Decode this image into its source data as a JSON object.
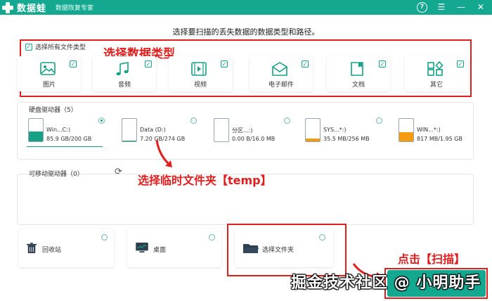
{
  "app": {
    "name": "数据蛙",
    "subtitle": "数据恢复专家"
  },
  "titlebar_buttons": [
    "help-icon",
    "menu-icon",
    "minimize-icon",
    "close-icon"
  ],
  "instruction": "选择要扫描的丢失数据的数据类型和路径。",
  "file_types": {
    "select_all_label": "选择所有文件类型",
    "items": [
      {
        "label": "图片",
        "icon": "image-icon",
        "checked": true
      },
      {
        "label": "音频",
        "icon": "music-icon",
        "checked": true
      },
      {
        "label": "视频",
        "icon": "video-icon",
        "checked": true
      },
      {
        "label": "电子邮件",
        "icon": "email-icon",
        "checked": true
      },
      {
        "label": "文档",
        "icon": "document-icon",
        "checked": true
      },
      {
        "label": "其它",
        "icon": "other-icon",
        "checked": true
      }
    ]
  },
  "hard_drives": {
    "title": "硬盘驱动器（5）",
    "items": [
      {
        "name": "Win...C:)",
        "size": "85.9 GB/200 GB",
        "selected": true,
        "used_fraction": 0.43,
        "fill_color": "#16a085"
      },
      {
        "name": "Data (D:)",
        "size": "7.20 GB/274 GB",
        "selected": false,
        "used_fraction": 0.03,
        "fill_color": "#16a085"
      },
      {
        "name": "分区...:)",
        "size": "0.00  B/16.0 MB",
        "selected": false,
        "used_fraction": 0.0,
        "fill_color": "#f39c12"
      },
      {
        "name": "SYS...*:)",
        "size": "35.5 MB/256 MB",
        "selected": false,
        "used_fraction": 0.14,
        "fill_color": "#f39c12"
      },
      {
        "name": "WIN...*:)",
        "size": "817 MB/1.95 GB",
        "selected": false,
        "used_fraction": 0.42,
        "fill_color": "#f39c12"
      }
    ]
  },
  "removable": {
    "title": "可移动驱动器（0）",
    "refresh_icon": "refresh-icon"
  },
  "locations": [
    {
      "label": "回收站",
      "icon": "recycle-bin-icon"
    },
    {
      "label": "桌面",
      "icon": "desktop-icon"
    },
    {
      "label": "选择文件夹",
      "icon": "folder-icon"
    }
  ],
  "annotations": {
    "select_type": "选择数据类型",
    "select_temp": "选择临时文件夹【temp】",
    "click_scan": "点击【扫描】"
  },
  "scan_button": {
    "label": "扫描"
  },
  "watermark": "掘金技术社区 @ 小明助手",
  "colors": {
    "brand": "#14a890",
    "annotation": "#e01e1e"
  }
}
